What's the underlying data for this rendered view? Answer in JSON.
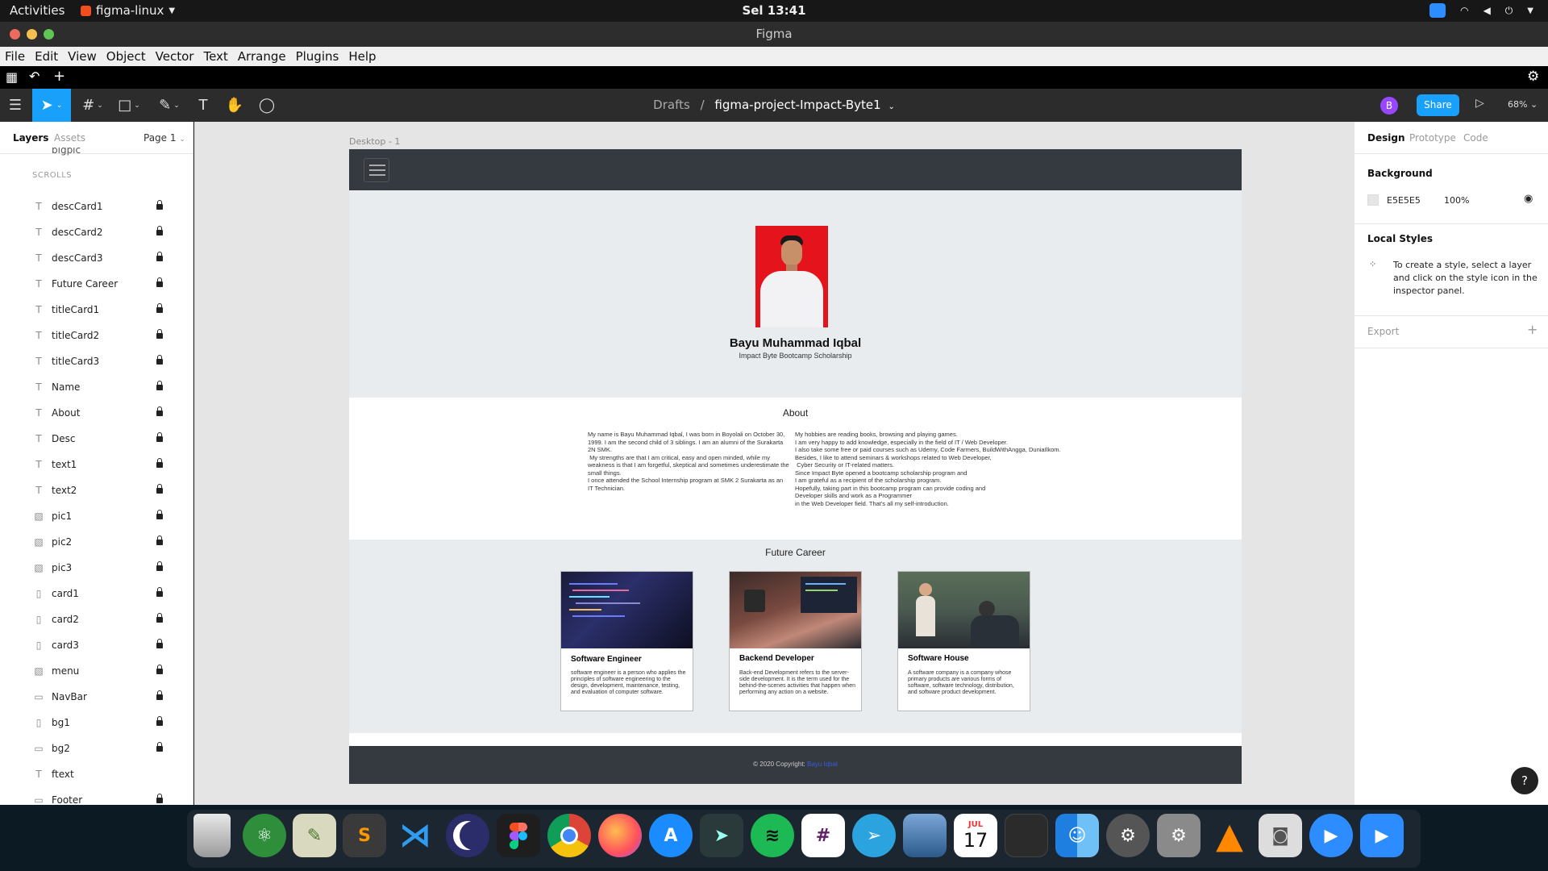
{
  "topbar": {
    "activities": "Activities",
    "app_name": "figma-linux",
    "clock": "Sel 13:41"
  },
  "window": {
    "title": "Figma"
  },
  "menubar": [
    "File",
    "Edit",
    "View",
    "Object",
    "Vector",
    "Text",
    "Arrange",
    "Plugins",
    "Help"
  ],
  "toolbar": {
    "breadcrumb_parent": "Drafts",
    "breadcrumb_sep": "/",
    "project_name": "figma-project-Impact-Byte1",
    "avatar_initial": "B",
    "share_label": "Share",
    "zoom": "68%"
  },
  "left_panel": {
    "tab_layers": "Layers",
    "tab_assets": "Assets",
    "page": "Page 1",
    "top_partial": "bigpic",
    "section_label": "SCROLLS",
    "layers": [
      {
        "icon": "T",
        "name": "descCard1",
        "locked": true
      },
      {
        "icon": "T",
        "name": "descCard2",
        "locked": true
      },
      {
        "icon": "T",
        "name": "descCard3",
        "locked": true
      },
      {
        "icon": "T",
        "name": "Future Career",
        "locked": true
      },
      {
        "icon": "T",
        "name": "titleCard1",
        "locked": true
      },
      {
        "icon": "T",
        "name": "titleCard2",
        "locked": true
      },
      {
        "icon": "T",
        "name": "titleCard3",
        "locked": true
      },
      {
        "icon": "T",
        "name": "Name",
        "locked": true
      },
      {
        "icon": "T",
        "name": "About",
        "locked": true
      },
      {
        "icon": "T",
        "name": "Desc",
        "locked": true
      },
      {
        "icon": "T",
        "name": "text1",
        "locked": true
      },
      {
        "icon": "T",
        "name": "text2",
        "locked": true
      },
      {
        "icon": "img",
        "name": "pic1",
        "locked": true
      },
      {
        "icon": "img",
        "name": "pic2",
        "locked": true
      },
      {
        "icon": "img",
        "name": "pic3",
        "locked": true
      },
      {
        "icon": "rect",
        "name": "card1",
        "locked": true
      },
      {
        "icon": "rect",
        "name": "card2",
        "locked": true
      },
      {
        "icon": "rect",
        "name": "card3",
        "locked": true
      },
      {
        "icon": "img",
        "name": "menu",
        "locked": true
      },
      {
        "icon": "line",
        "name": "NavBar",
        "locked": true
      },
      {
        "icon": "rect",
        "name": "bg1",
        "locked": true
      },
      {
        "icon": "line",
        "name": "bg2",
        "locked": true
      },
      {
        "icon": "T",
        "name": "ftext",
        "locked": false
      },
      {
        "icon": "line",
        "name": "Footer",
        "locked": true
      }
    ]
  },
  "canvas": {
    "frame_label": "Desktop - 1",
    "profile_name": "Bayu Muhammad Iqbal",
    "profile_subtitle": "Impact Byte Bootcamp Scholarship",
    "about_heading": "About",
    "about_left": "My name is Bayu Muhammad Iqbal, I was born in Boyolali on October 30, 1999. I am the second child of 3 siblings. I am an alumni of the Surakarta 2N SMK.\n My strengths are that I am critical, easy and open minded, while my weakness is that I am forgetful, skeptical and sometimes underestimate the small things.\nI once attended the School Internship program at SMK 2 Surakarta as an IT Technician.",
    "about_right": "My hobbies are reading books, browsing and playing games.\nI am very happy to add knowledge, especially in the field of IT / Web Developer.\nI also take some free or paid courses such as Udemy, Code Farmers, BuildWithAngga, DuniaIlkom.\nBesides, I like to attend seminars & workshops related to Web Developer,\n Cyber Security or IT-related matters.\nSince Impact Byte opened a bootcamp scholarship program and\nI am grateful as a recipient of the scholarship program.\nHopefully, taking part in this bootcamp program can provide coding and\nDeveloper skills and work as a Programmer\nin the Web Developer field. That's all my self-introduction.",
    "career_heading": "Future Career",
    "cards": [
      {
        "title": "Software Engineer",
        "desc": "software engineer is a person who applies the principles of software engineering to the design, development, maintenance, testing, and evaluation of computer software."
      },
      {
        "title": "Backend Developer",
        "desc": "Back-end Development refers to the server-side development. It is the term used for the behind-the-scenes activities that happen when performing any action on a website."
      },
      {
        "title": "Software House",
        "desc": "A software company is a company whose primary products are various forms of software, software technology, distribution, and software product development."
      }
    ],
    "footer_text": "© 2020 Copyright:",
    "footer_link": "Bayu Iqbal"
  },
  "right_panel": {
    "tab_design": "Design",
    "tab_prototype": "Prototype",
    "tab_code": "Code",
    "background_label": "Background",
    "background_hex": "E5E5E5",
    "background_opacity": "100%",
    "local_styles_label": "Local Styles",
    "local_styles_hint": "To create a style, select a layer and click on the style icon in the inspector panel.",
    "export_label": "Export",
    "help": "?"
  },
  "dock_apps": [
    "trash",
    "atom",
    "notes",
    "sublime-text",
    "vscode",
    "eclipse",
    "figma",
    "chrome",
    "firefox",
    "app-store",
    "terminal",
    "spotify",
    "slack",
    "telegram",
    "preview",
    "calendar",
    "dark-app",
    "finder",
    "settings-alt",
    "system-preferences",
    "vlc",
    "screenshot",
    "zoom",
    "zoom-meetings"
  ],
  "calendar": {
    "month": "JUL",
    "day": "17"
  },
  "colors": {
    "accent": "#18a0fb",
    "nav": "#343a40",
    "canvas_bg": "#e5e5e5",
    "frame_section": "#e9ecef"
  }
}
